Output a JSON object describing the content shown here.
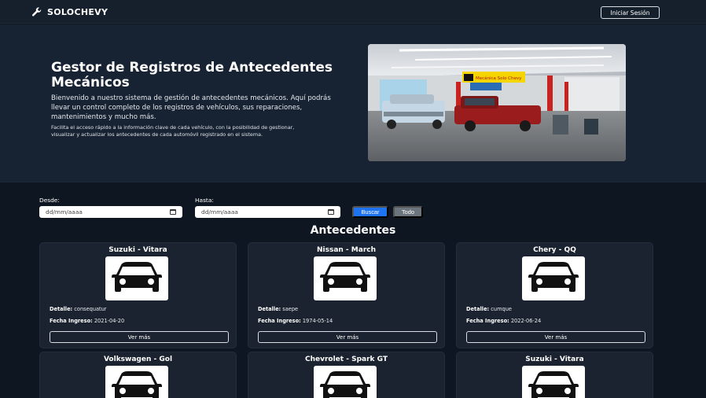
{
  "navbar": {
    "brand": "SOLOCHEVY",
    "login_label": "Iniciar Sesión"
  },
  "hero": {
    "title": "Gestor de Registros de Antecedentes Mecánicos",
    "lead": "Bienvenido a nuestro sistema de gestión de antecedentes mecánicos. Aquí podrás llevar un control completo de los registros de vehículos, sus reparaciones, mantenimientos y mucho más.",
    "small": "Facilita el acceso rápido a la información clave de cada vehículo, con la posibilidad de gestionar, visualizar y actualizar los antecedentes de cada automóvil registrado en el sistema.",
    "image_sign": "Mecánica Solo Chevy"
  },
  "filters": {
    "desde_label": "Desde:",
    "hasta_label": "Hasta:",
    "date_placeholder": "dd/mm/aaaa",
    "buscar_label": "Buscar",
    "todo_label": "Todo"
  },
  "section_title": "Antecedentes",
  "labels": {
    "detalle": "Detalle:",
    "fecha": "Fecha Ingreso:",
    "ver_mas": "Ver más"
  },
  "cards": [
    {
      "title": "Suzuki - Vitara",
      "detalle": "consequatur",
      "fecha": "2021-04-20"
    },
    {
      "title": "Nissan - March",
      "detalle": "saepe",
      "fecha": "1974-05-14"
    },
    {
      "title": "Chery - QQ",
      "detalle": "cumque",
      "fecha": "2022-06-24"
    },
    {
      "title": "Volkswagen - Gol"
    },
    {
      "title": "Chevrolet - Spark GT"
    },
    {
      "title": "Suzuki - Vitara"
    }
  ],
  "colors": {
    "background": "#0e1622",
    "hero": "#172232",
    "card": "#1b2330",
    "primary": "#1e73f0",
    "secondary": "#6c757d"
  },
  "icons": [
    "wrench-icon",
    "calendar-icon",
    "car-icon"
  ]
}
